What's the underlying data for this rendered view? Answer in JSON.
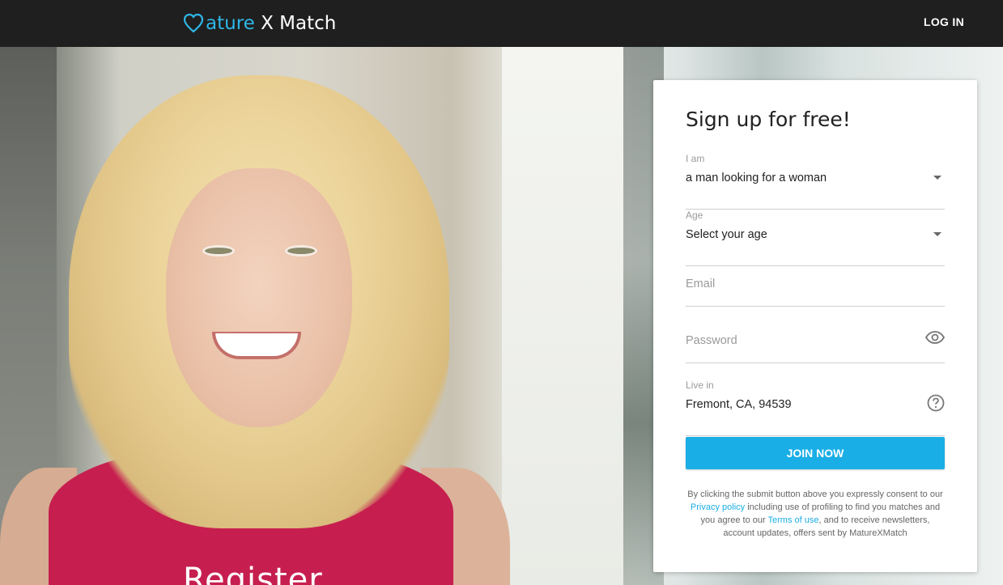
{
  "header": {
    "logo_part1": "M",
    "logo_part2": "ature",
    "logo_part3": " X Match",
    "login_label": "LOG IN"
  },
  "hero": {
    "register_text": "Register"
  },
  "signup": {
    "title": "Sign up for free!",
    "iam_label": "I am",
    "iam_value": "a man looking for a woman",
    "age_label": "Age",
    "age_value": "Select your age",
    "email_placeholder": "Email",
    "password_placeholder": "Password",
    "live_label": "Live in",
    "live_value": "Fremont, CA, 94539",
    "join_label": "JOIN NOW",
    "legal_1": "By clicking the submit button above you expressly consent to our ",
    "privacy_link": "Privacy policy",
    "legal_2": " including use of profiling to find you matches and you agree to our ",
    "terms_link": "Terms of use",
    "legal_3": ", and to receive newsletters, account updates, offers sent by MatureXMatch"
  },
  "colors": {
    "accent": "#1aaee6",
    "logo_accent": "#2fb7e6",
    "header_bg": "#1f1f1f"
  },
  "icons": [
    "heart-logo-icon",
    "chevron-down-icon",
    "eye-icon",
    "help-icon"
  ]
}
